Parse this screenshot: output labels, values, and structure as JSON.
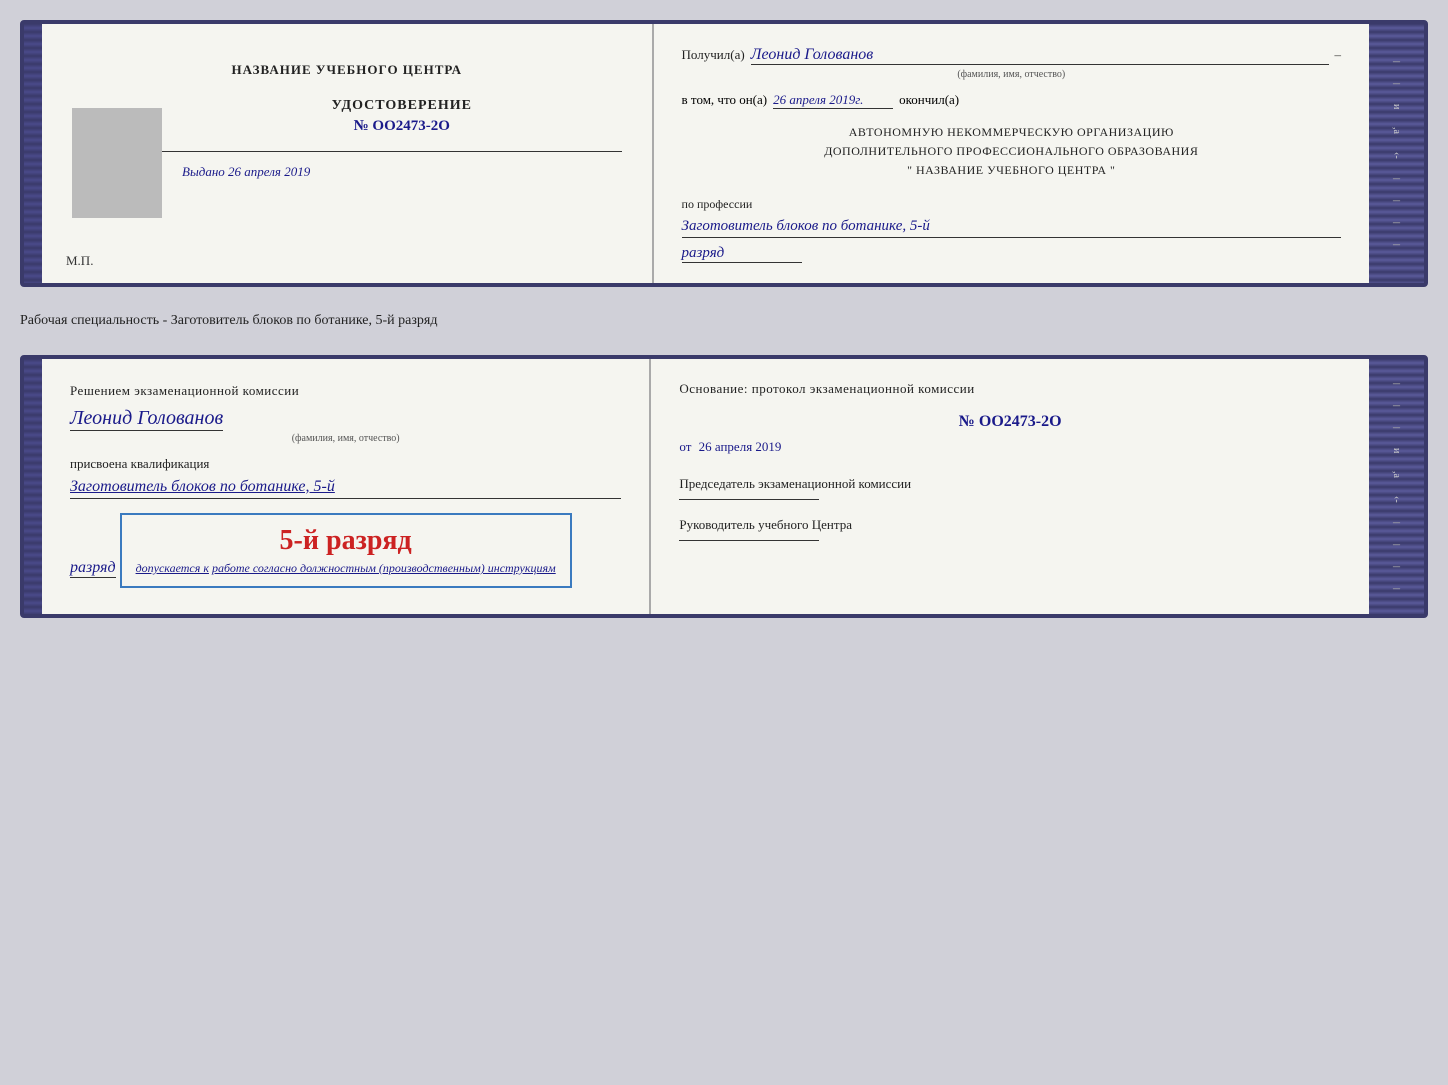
{
  "top_doc": {
    "left": {
      "center_title": "НАЗВАНИЕ УЧЕБНОГО ЦЕНТРА",
      "cert_title": "УДОСТОВЕРЕНИЕ",
      "cert_number": "№ OO2473-2O",
      "issued_label": "Выдано",
      "issued_date": "26 апреля 2019",
      "mp_label": "М.П."
    },
    "right": {
      "received_prefix": "Получил(а)",
      "received_name": "Леонид Голованов",
      "name_hint": "(фамилия, имя, отчество)",
      "date_prefix": "в том, что он(а)",
      "date_value": "26 апреля 2019г.",
      "date_suffix": "окончил(а)",
      "org_line1": "АВТОНОМНУЮ НЕКОММЕРЧЕСКУЮ ОРГАНИЗАЦИЮ",
      "org_line2": "ДОПОЛНИТЕЛЬНОГО ПРОФЕССИОНАЛЬНОГО ОБРАЗОВАНИЯ",
      "org_line3": "\"   НАЗВАНИЕ УЧЕБНОГО ЦЕНТРА   \"",
      "profession_label": "по профессии",
      "profession_value": "Заготовитель блоков по ботанике, 5-й",
      "razryad_value": "разряд"
    }
  },
  "separator": {
    "text": "Рабочая специальность - Заготовитель блоков по ботанике, 5-й разряд"
  },
  "bottom_doc": {
    "left": {
      "decision_text": "Решением экзаменационной комиссии",
      "person_name": "Леонид Голованов",
      "name_hint": "(фамилия, имя, отчество)",
      "assigned_label": "присвоена квалификация",
      "qual_value": "Заготовитель блоков по ботанике, 5-й",
      "razryad_value": "разряд",
      "stamp_rank": "5-й разряд",
      "stamp_prefix": "допускается к",
      "stamp_italic": "работе согласно должностным (производственным) инструкциям"
    },
    "right": {
      "basis_label": "Основание: протокол экзаменационной комиссии",
      "protocol_number": "№  OO2473-2O",
      "from_prefix": "от",
      "from_date": "26 апреля 2019",
      "chairman_label": "Председатель экзаменационной комиссии",
      "head_label": "Руководитель учебного Центра"
    }
  }
}
